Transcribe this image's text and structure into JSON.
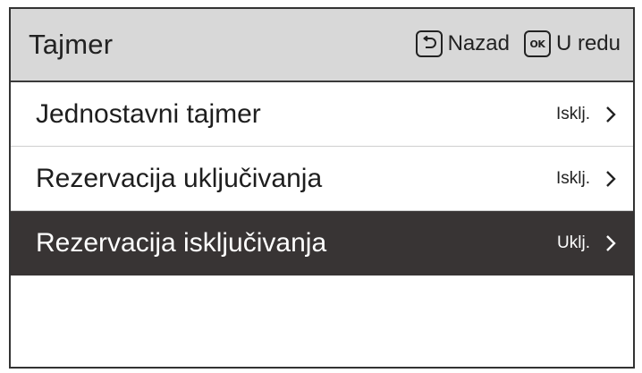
{
  "header": {
    "title": "Tajmer",
    "back_label": "Nazad",
    "back_icon": "back-arrow-icon",
    "ok_key_text": "OK",
    "ok_label": "U redu"
  },
  "menu": {
    "items": [
      {
        "label": "Jednostavni tajmer",
        "status": "Isklj.",
        "selected": false
      },
      {
        "label": "Rezervacija uključivanja",
        "status": "Isklj.",
        "selected": false
      },
      {
        "label": "Rezervacija isključivanja",
        "status": "Uklj.",
        "selected": true
      }
    ]
  },
  "colors": {
    "header_bg": "#d8d8d8",
    "selected_bg": "#383434",
    "text": "#1e1e1e",
    "selected_text": "#ffffff"
  }
}
